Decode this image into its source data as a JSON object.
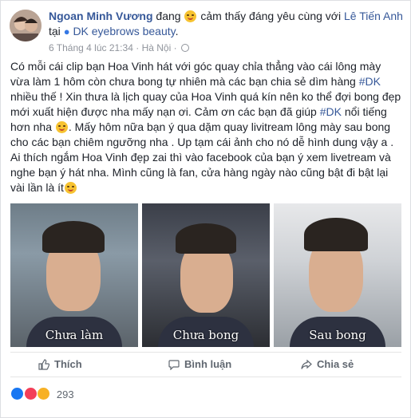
{
  "header": {
    "author": "Ngoan Minh Vương",
    "status_pre": "đang",
    "feeling": "cảm thấy đáng yêu",
    "with": "cùng với",
    "tagged": "Lê Tiến Anh",
    "at": "tại",
    "place": "DK eyebrows beauty",
    "time": "6 Tháng 4 lúc 21:34",
    "location": "Hà Nội",
    "sep": "·"
  },
  "post": {
    "part1": "Có mỗi cái clip bạn Hoa Vinh hát với góc quay chỉa thẳng vào cái lông mày vừa làm 1 hôm còn chưa bong tự nhiên mà các bạn chia sẻ dìm hàng",
    "hashtag1": "#DK",
    "part2": "nhiều thế ! Xin thưa là lịch quay của Hoa Vinh quá kín nên ko thể đợi bong đẹp mới xuất hiện được nha mấy nạn ơi. Cảm ơn các bạn đã giúp",
    "hashtag2": "#DK",
    "part3": "nổi tiếng hơn nha",
    "part4": ". Mấy hôm nữa bạn ý qua dặm quay livitream lông mày sau bong cho các bạn chiêm ngưỡng nha . Up tạm cái ảnh cho nó dễ hình dung vậy a . Ai thích ngắm Hoa Vinh đẹp zai thì vào facebook của bạn ý xem livetream và nghe bạn ý hát nha. Mình cũng là fan, cửa hàng ngày nào cũng bật đi bật lại vài lần là ít"
  },
  "photos": [
    {
      "caption": "Chưa làm"
    },
    {
      "caption": "Chưa bong"
    },
    {
      "caption": "Sau bong"
    }
  ],
  "actions": {
    "like": "Thích",
    "comment": "Bình luận",
    "share": "Chia sẻ"
  },
  "reactions": {
    "count": "293",
    "types": [
      "like-icon",
      "love-icon",
      "haha-icon"
    ]
  },
  "colors": {
    "link": "#365899",
    "meta": "#90949c",
    "action": "#606770",
    "like_blue": "#1877f2",
    "love_red": "#f33e58"
  }
}
